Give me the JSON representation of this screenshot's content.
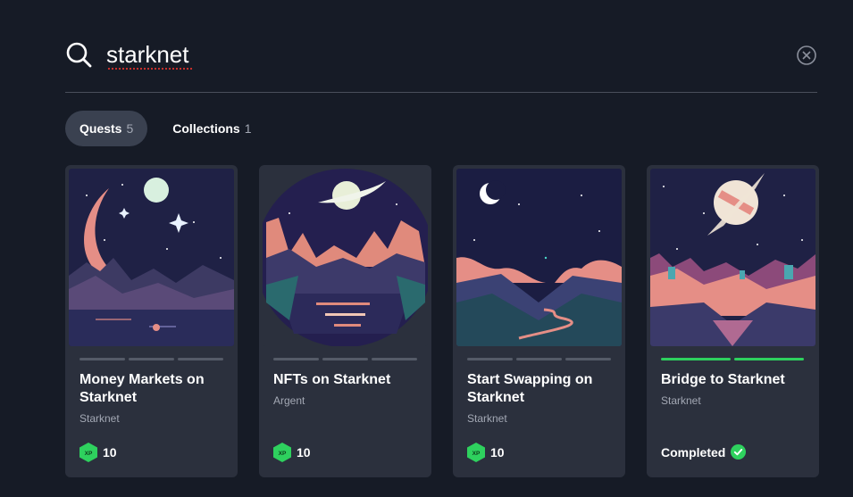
{
  "search": {
    "query": "starknet"
  },
  "tabs": [
    {
      "label": "Quests",
      "count": "5"
    },
    {
      "label": "Collections",
      "count": "1"
    }
  ],
  "cards": [
    {
      "title": "Money Markets on Starknet",
      "subtitle": "Starknet",
      "xp": "10",
      "progress_done": 0,
      "progress_total": 3
    },
    {
      "title": "NFTs on Starknet",
      "subtitle": "Argent",
      "xp": "10",
      "progress_done": 0,
      "progress_total": 3
    },
    {
      "title": "Start Swapping on Starknet",
      "subtitle": "Starknet",
      "xp": "10",
      "progress_done": 0,
      "progress_total": 3
    },
    {
      "title": "Bridge to Starknet",
      "subtitle": "Starknet",
      "status": "Completed",
      "progress_done": 2,
      "progress_total": 2
    }
  ],
  "xp_badge_label": "XP",
  "colors": {
    "background": "#161b26",
    "card": "#2b303d",
    "accent_green": "#2ed15e",
    "active_tab": "#3a4150"
  }
}
